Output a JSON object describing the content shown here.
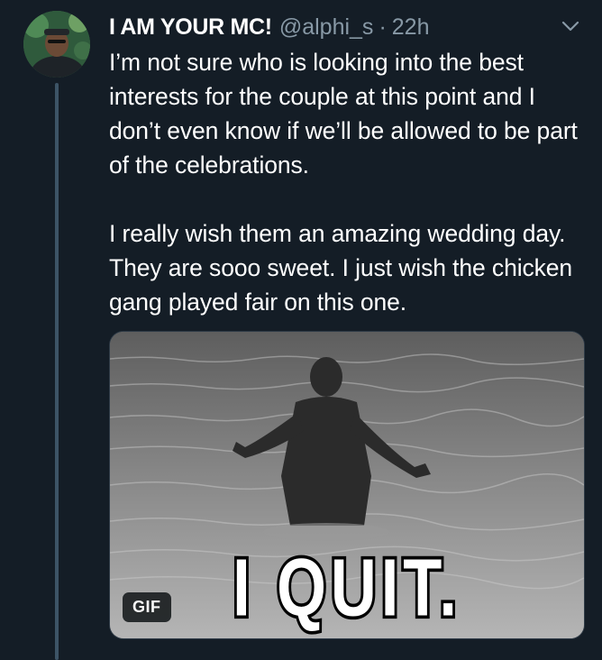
{
  "tweet": {
    "display_name": "I AM YOUR MC!",
    "handle": "@alphi_s",
    "separator": "·",
    "time": "22h",
    "paragraphs": [
      "I’m not sure who is looking into the best interests for the couple at this point and I don’t even know if we’ll be allowed to be part of the celebrations.",
      "I really wish them an amazing wedding day. They are sooo sweet. I just wish the chicken gang played fair on this one."
    ],
    "media": {
      "badge": "GIF",
      "caption": "I QUIT."
    }
  },
  "icons": {
    "menu": "chevron-down-icon"
  },
  "colors": {
    "background": "#141d26",
    "secondary_text": "#8899a6",
    "thread_line": "#3d5466"
  }
}
